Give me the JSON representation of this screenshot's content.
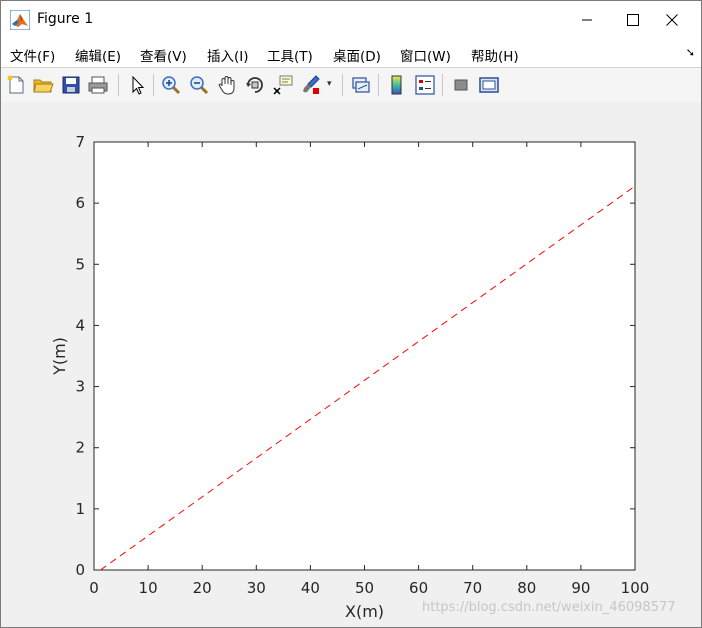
{
  "window": {
    "title": "Figure 1"
  },
  "menu": {
    "items": [
      {
        "label": "文件(F)"
      },
      {
        "label": "编辑(E)"
      },
      {
        "label": "查看(V)"
      },
      {
        "label": "插入(I)"
      },
      {
        "label": "工具(T)"
      },
      {
        "label": "桌面(D)"
      },
      {
        "label": "窗口(W)"
      },
      {
        "label": "帮助(H)"
      }
    ]
  },
  "toolbar": {
    "icons": [
      "new-figure-icon",
      "open-file-icon",
      "save-icon",
      "print-icon",
      "select-pointer-icon",
      "zoom-in-icon",
      "zoom-out-icon",
      "pan-icon",
      "rotate-3d-icon",
      "data-cursor-icon",
      "brush-icon",
      "link-plot-icon",
      "insert-colorbar-icon",
      "insert-legend-icon",
      "hide-plot-tools-icon",
      "show-plot-tools-icon"
    ]
  },
  "chart_data": {
    "type": "line",
    "title": "",
    "xlabel": "X(m)",
    "ylabel": "Y(m)",
    "xlim": [
      0,
      100
    ],
    "ylim": [
      0,
      7
    ],
    "x_ticks": [
      0,
      10,
      20,
      30,
      40,
      50,
      60,
      70,
      80,
      90,
      100
    ],
    "y_ticks": [
      0,
      1,
      2,
      3,
      4,
      5,
      6,
      7
    ],
    "series": [
      {
        "x": [
          1.2,
          100
        ],
        "y": [
          0,
          6.28
        ],
        "color": "#ff0000",
        "style": "dashed"
      }
    ],
    "grid": false
  },
  "watermark": "https://blog.csdn.net/weixin_46098577"
}
